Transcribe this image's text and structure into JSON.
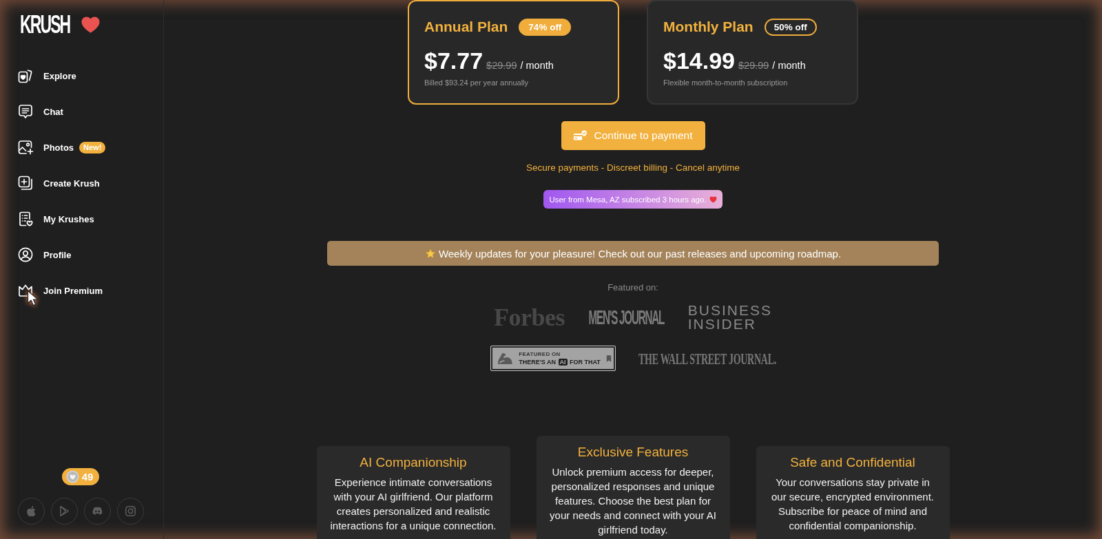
{
  "sidebar": {
    "logo": "KRUSH",
    "items": [
      {
        "label": "Explore",
        "selected": false
      },
      {
        "label": "Chat",
        "selected": false
      },
      {
        "label": "Photos",
        "badge": "New!",
        "selected": false
      },
      {
        "label": "Create Krush",
        "selected": false
      },
      {
        "label": "My Krushes",
        "selected": false
      },
      {
        "label": "Profile",
        "selected": false
      },
      {
        "label": "Join Premium",
        "selected": false
      }
    ],
    "coins": "49"
  },
  "plans": [
    {
      "name": "Annual Plan",
      "discount": "74% off",
      "price": "$7.77",
      "old_price": "$29.99",
      "period": "/ month",
      "note": "Billed $93.24 per year annually",
      "selected": true
    },
    {
      "name": "Monthly Plan",
      "discount": "50% off",
      "price": "$14.99",
      "old_price": "$29.99",
      "period": "/ month",
      "note": "Flexible month-to-month subscription",
      "selected": false
    }
  ],
  "checkout": {
    "button": "Continue to payment",
    "assurance": "Secure payments - Discreet billing - Cancel anytime",
    "notification": "User from Mesa, AZ subscribed 3 hours ago."
  },
  "banner": {
    "text": "Weekly updates for your pleasure! Check out our past releases and upcoming roadmap."
  },
  "featured": {
    "heading": "Featured on:",
    "logos": [
      {
        "kind": "serif",
        "text": "Forbes"
      },
      {
        "kind": "condensed",
        "text": "MEN'S JOURNAL"
      },
      {
        "kind": "stacked",
        "lines": [
          "BUSINESS",
          "INSIDER"
        ]
      },
      {
        "kind": "badge",
        "caption": "FEATURED ON",
        "title": "THERE'S AN **AI** FOR THAT"
      },
      {
        "kind": "newspaper",
        "text": "THE WALL STREET JOURNAL."
      }
    ]
  },
  "features": [
    {
      "title": "AI Companionship",
      "text": "Experience intimate conversations with your AI girlfriend. Our platform creates personalized and realistic interactions for a unique connection."
    },
    {
      "title": "Exclusive Features",
      "text": "Unlock premium access for deeper, personalized responses and unique features. Choose the best plan for your needs and connect with your AI girlfriend today."
    },
    {
      "title": "Safe and Confidential",
      "text": "Your conversations stay private in our secure, encrypted environment. Subscribe for peace of mind and confidential companionship."
    }
  ]
}
